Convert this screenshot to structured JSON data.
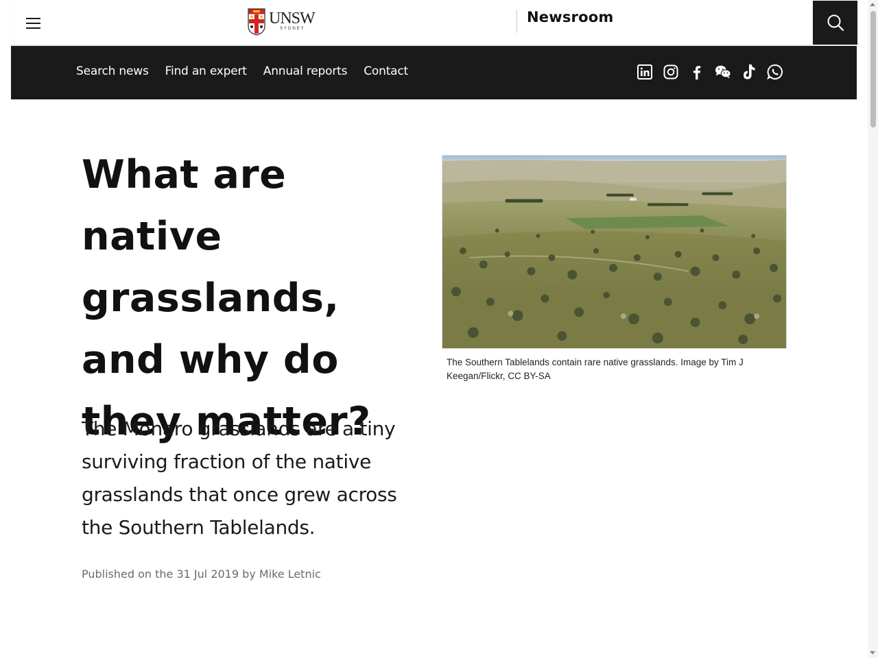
{
  "header": {
    "menu_icon": "hamburger-menu-icon",
    "logo_text": "UNSW",
    "logo_subtext": "SYDNEY",
    "section_title": "Newsroom",
    "search_icon": "search-icon"
  },
  "nav": {
    "links": [
      {
        "label": "Search news"
      },
      {
        "label": "Find an expert"
      },
      {
        "label": "Annual reports"
      },
      {
        "label": "Contact"
      }
    ],
    "socials": [
      "linkedin-icon",
      "instagram-icon",
      "facebook-icon",
      "wechat-icon",
      "tiktok-icon",
      "whatsapp-icon"
    ]
  },
  "article": {
    "title": "What are native grasslands, and why do they matter?",
    "standfirst": "The Monaro grasslands are a tiny surviving fraction of the native grasslands that once grew across the Southern Tablelands.",
    "meta": "Published on the 31 Jul 2019 by Mike Letnic",
    "image_caption": "The Southern Tablelands contain rare native grasslands. Image by Tim J Keegan/Flickr, CC BY-SA"
  },
  "colors": {
    "nav_background": "#1a1a1a",
    "text": "#111111",
    "meta": "#6b6b6b",
    "brand_red": "#d2232a",
    "brand_gold": "#f2c500"
  }
}
